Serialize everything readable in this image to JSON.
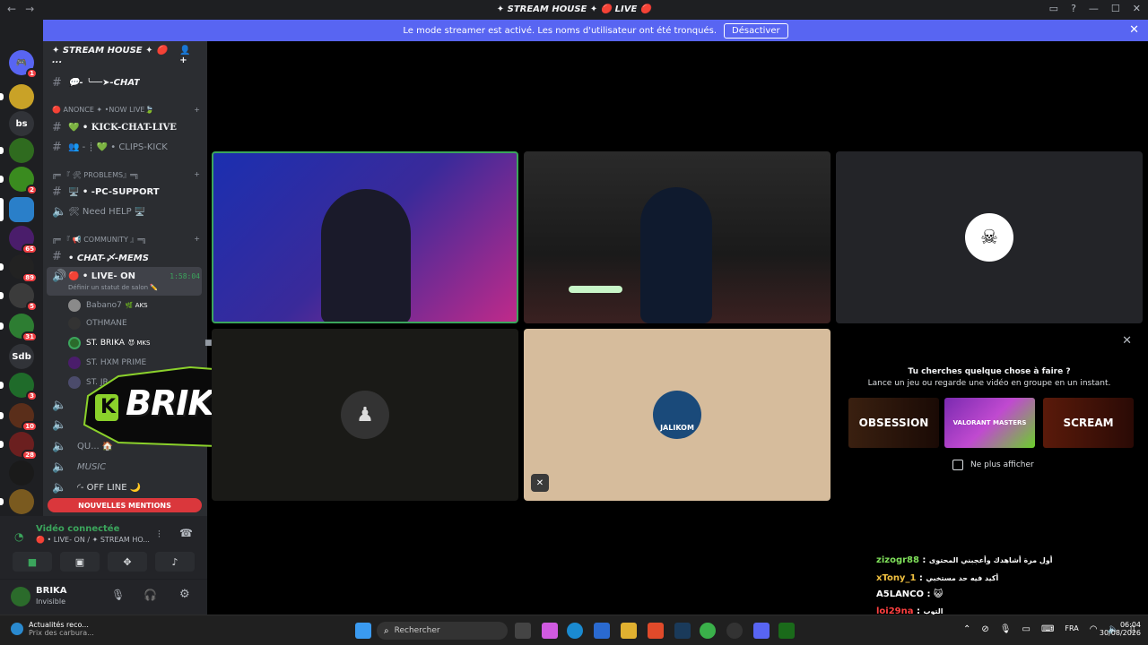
{
  "window": {
    "title": "✦ STREAM HOUSE ✦ 🔴 LIVE 🔴",
    "back": "←",
    "forward": "→"
  },
  "streamer_banner": {
    "text": "Le mode streamer est activé. Les noms d'utilisateur ont été tronqués.",
    "button": "Désactiver"
  },
  "server_list": {
    "items": [
      {
        "label": "",
        "badge": "1"
      },
      {
        "label": "",
        "badge": ""
      },
      {
        "label": "bs",
        "badge": ""
      },
      {
        "label": "",
        "badge": ""
      },
      {
        "label": "",
        "badge": "2"
      },
      {
        "label": "",
        "badge": ""
      },
      {
        "label": "",
        "badge": "65"
      },
      {
        "label": "",
        "badge": "89"
      },
      {
        "label": "",
        "badge": "5"
      },
      {
        "label": "",
        "badge": "31"
      },
      {
        "label": "Sdb",
        "badge": ""
      },
      {
        "label": "",
        "badge": "3"
      },
      {
        "label": "",
        "badge": "10"
      },
      {
        "label": "",
        "badge": "28"
      },
      {
        "label": "",
        "badge": ""
      },
      {
        "label": "",
        "badge": ""
      }
    ]
  },
  "server": {
    "name": "✦ STREAM HOUSE ✦ 🔴 ..."
  },
  "channels": {
    "chat": "💬- ╰──➤-CHAT",
    "cat_annonce": "🔴 ANONCE ✦ •NOW LIVE🍃",
    "kick_chat_live": "💚 • KICK-CHAT-LIVE",
    "clips_kick": "👥 - ┊ 💚 • CLIPS-KICK",
    "cat_problems": "╔═ 『 🛠 PROBLEMS』═╗",
    "pc_support": "🖥️ • -PC-SUPPORT",
    "need_help": "🛠 Need HELP 🖥️",
    "cat_community": "╔═ 『 📢 COMMUNITY 』═╗",
    "chat_mems": "• CHAT-〆-MEMS",
    "live_on": "🔴 • LIVE- ON",
    "live_timer": "1:58:04",
    "live_status": "Définir un statut de salon ✏️",
    "music": "MUSIC",
    "offline": "◜- OFF LINE 🌙",
    "quartier": "QU... 🏠"
  },
  "members": [
    {
      "name": "Babano7",
      "tag": "🌿 AKS"
    },
    {
      "name": "OTHMANE",
      "tag": ""
    },
    {
      "name": "ST. BRIKA",
      "tag": "😈 MKS"
    },
    {
      "name": "ST. HXM PRIME",
      "tag": ""
    },
    {
      "name": "ST. JR",
      "tag": ""
    }
  ],
  "overlay_logo": "BRIKAO",
  "overlay_k": "K",
  "mentions_button": "NOUVELLES MENTIONS",
  "voice": {
    "status": "Vidéo connectée",
    "location": "🔴 • LIVE- ON / ✦ STREAM HO..."
  },
  "user": {
    "name": "BRIKA",
    "status": "Invisible"
  },
  "suggestions": {
    "title": "Tu cherches quelque chose à faire ?",
    "subtitle": "Lance un jeu ou regarde une vidéo en groupe en un instant.",
    "cards": [
      "OBSESSION",
      "VALORANT MASTERS",
      "SCREAM"
    ],
    "checkbox": "Ne plus afficher"
  },
  "tile_labels": {
    "jalikom": "JALIKOM"
  },
  "stream_chat": [
    {
      "user": "zizogr88",
      "msg": "أول مرة أشاهدك وأعجبني المحتوى"
    },
    {
      "user": "xTony_1",
      "msg": "أكيد فيه حد مستخبي"
    },
    {
      "user": "A5LANCO",
      "msg": "😺"
    },
    {
      "user": "loi29na",
      "msg": "التوب"
    }
  ],
  "taskbar": {
    "news_title": "Actualités reco...",
    "news_sub": "Prix des carbura...",
    "search": "Rechercher",
    "lang": "FRA",
    "time": "06:04",
    "date": "30/08/2026"
  },
  "colors": {
    "accent": "#5865f2",
    "danger": "#da373c",
    "speaking": "#3ba55c"
  }
}
